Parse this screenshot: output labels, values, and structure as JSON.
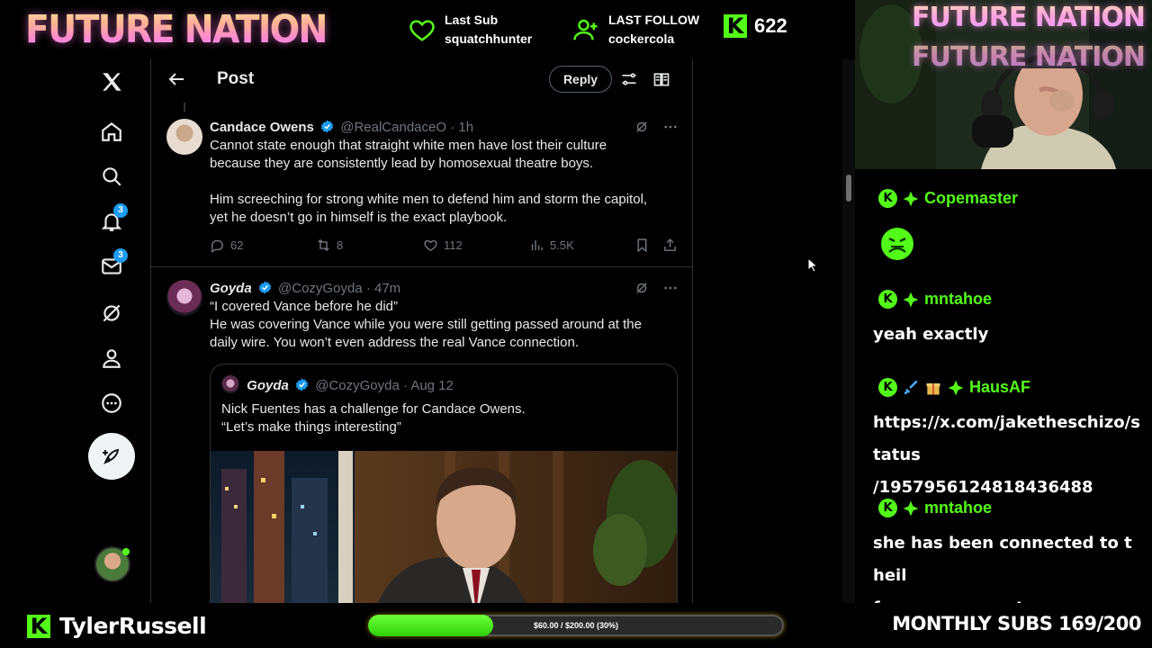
{
  "overlay": {
    "brand": "FUTURE NATION",
    "last_sub_label": "Last Sub",
    "last_sub_value": "squatchhunter",
    "last_follow_label": "LAST FOLLOW",
    "last_follow_value": "cockercola",
    "kick_viewers": "622",
    "kick_logo": "K"
  },
  "twitter": {
    "nav": {
      "notification_badge": "3",
      "messages_badge": "3",
      "icons": [
        "x-logo-icon",
        "home-icon",
        "search-icon",
        "bell-icon",
        "mail-icon",
        "grok-icon",
        "profile-icon",
        "more-icon",
        "compose-icon"
      ]
    },
    "header": {
      "title": "Post",
      "reply_label": "Reply"
    },
    "tweets": [
      {
        "name": "Candace Owens",
        "handle": "@RealCandaceO",
        "time": "· 1h",
        "text_line1": "Cannot state enough that straight white men have lost their culture",
        "text_line2": "because they are consistently lead by homosexual theatre boys.",
        "text_line3": "Him screeching for strong white men to defend him and storm the capitol,",
        "text_line4": "yet he doesn’t go in himself is the exact playbook.",
        "replies": "62",
        "reposts": "8",
        "likes": "112",
        "views": "5.5K"
      },
      {
        "name": "Goyda",
        "handle": "@CozyGoyda",
        "time": "· 47m",
        "text_line1": "“I covered Vance before he did”",
        "text_line2": "He was covering Vance while you were still getting passed around at the",
        "text_line3": "daily wire. You won’t even address the real Vance connection.",
        "quote": {
          "name": "Goyda",
          "handle": "@CozyGoyda",
          "time": "· Aug 12",
          "text_line1": "Nick Fuentes has a challenge for Candace Owens.",
          "text_line2": "“Let’s make things interesting”"
        }
      }
    ]
  },
  "webcam": {
    "neon_sign": "FUTURE NATION"
  },
  "chat": {
    "messages": [
      {
        "user": "Copemaster",
        "text": "",
        "emote": "green-face-emote"
      },
      {
        "user": "mntahoe",
        "text": "yeah exactly"
      },
      {
        "user": "HausAF",
        "text_line1": "https://x.com/jaketheschizo/status",
        "text_line2": "/1957956124818436488"
      },
      {
        "user": "mntahoe",
        "text_line1": "she has been connected to theil",
        "text_line2": "for many years too"
      }
    ],
    "badge_letter": "K"
  },
  "bottom": {
    "streamer": "TylerRussell",
    "goal_text": "$60.00 / $200.00 (30%)",
    "goal_fraction": 0.3,
    "monthly_subs": "MONTHLY SUBS 169/200"
  },
  "colors": {
    "kick_green": "#53fc18",
    "x_blue": "#1d9bf0",
    "muted": "#71767b"
  }
}
